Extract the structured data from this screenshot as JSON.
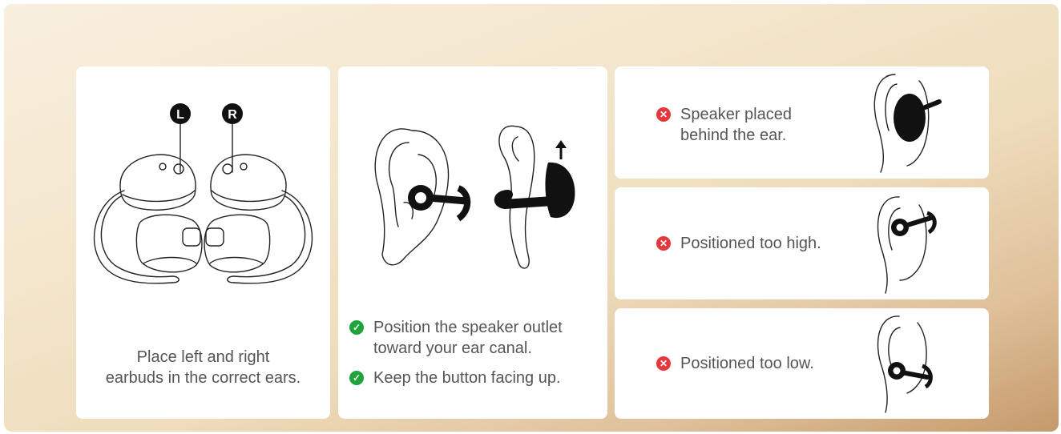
{
  "left_panel": {
    "badge_left": "L",
    "badge_right": "R",
    "caption_line1": "Place left and right",
    "caption_line2": "earbuds in the correct ears."
  },
  "middle_panel": {
    "tip1_line1": "Position the speaker outlet",
    "tip1_line2": "toward your ear canal.",
    "tip2": "Keep the button facing up.",
    "check_icon": "check-circle-icon"
  },
  "wrong_panels": [
    {
      "line1": "Speaker placed",
      "line2": "behind the ear.",
      "icon": "x-circle-icon"
    },
    {
      "line1": "Positioned too high.",
      "icon": "x-circle-icon"
    },
    {
      "line1": "Positioned too low.",
      "icon": "x-circle-icon"
    }
  ],
  "colors": {
    "check": "#1fa33a",
    "cross": "#e5383b",
    "text": "#555555",
    "background_light": "#f8efde",
    "background_dark": "#c59a6b"
  }
}
